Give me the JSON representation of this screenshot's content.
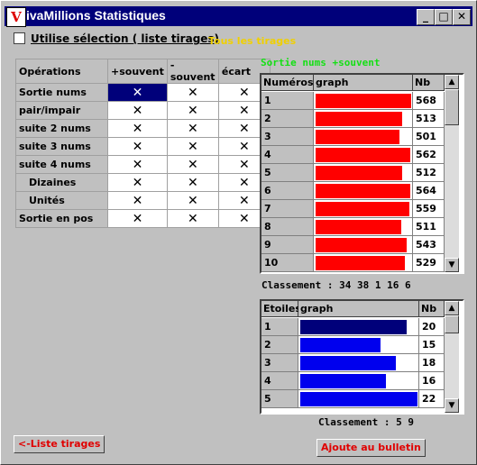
{
  "window": {
    "title": "ivaMillions Statistiques",
    "icon_letter": "V",
    "buttons": {
      "minimize": "_",
      "maximize": "□",
      "close": "✕"
    }
  },
  "options": {
    "use_selection_label": "Utilise sélection ( liste tirages)",
    "use_selection_checked": false,
    "all_draws_label": "Tous les tirages"
  },
  "operations": {
    "headers": [
      "Opérations",
      "+souvent",
      "-souvent",
      "écart"
    ],
    "mark": "✕",
    "rows": [
      {
        "name": "Sortie nums",
        "selected_col": 1
      },
      {
        "name": "pair/impair"
      },
      {
        "name": "suite 2 nums"
      },
      {
        "name": "suite 3 nums"
      },
      {
        "name": "suite 4 nums"
      },
      {
        "name": "Dizaines",
        "indent": true
      },
      {
        "name": "Unités",
        "indent": true
      },
      {
        "name": "Sortie en pos"
      }
    ]
  },
  "numbers_panel": {
    "heading": "Sortie nums +souvent",
    "headers": [
      "Numéros",
      "graph",
      "Nb"
    ],
    "bar_color": "#ff0000",
    "max": 568,
    "rows": [
      {
        "label": "1",
        "nb": 568
      },
      {
        "label": "2",
        "nb": 513
      },
      {
        "label": "3",
        "nb": 501
      },
      {
        "label": "4",
        "nb": 562
      },
      {
        "label": "5",
        "nb": 512
      },
      {
        "label": "6",
        "nb": 564
      },
      {
        "label": "7",
        "nb": 559
      },
      {
        "label": "8",
        "nb": 511
      },
      {
        "label": "9",
        "nb": 543
      },
      {
        "label": "10",
        "nb": 529
      }
    ],
    "classement": "Classement : 34 38 1 16 6"
  },
  "stars_panel": {
    "headers": [
      "Etoiles",
      "graph",
      "Nb"
    ],
    "bar_color": "#0000ee",
    "selected_bar_color": "#00007a",
    "max": 22,
    "rows": [
      {
        "label": "1",
        "nb": 20,
        "selected": true
      },
      {
        "label": "2",
        "nb": 15
      },
      {
        "label": "3",
        "nb": 18
      },
      {
        "label": "4",
        "nb": 16
      },
      {
        "label": "5",
        "nb": 22
      }
    ],
    "classement": "Classement : 5 9"
  },
  "buttons": {
    "list_draws": "<-Liste tirages",
    "add_to_ticket": "Ajoute au bulletin"
  }
}
